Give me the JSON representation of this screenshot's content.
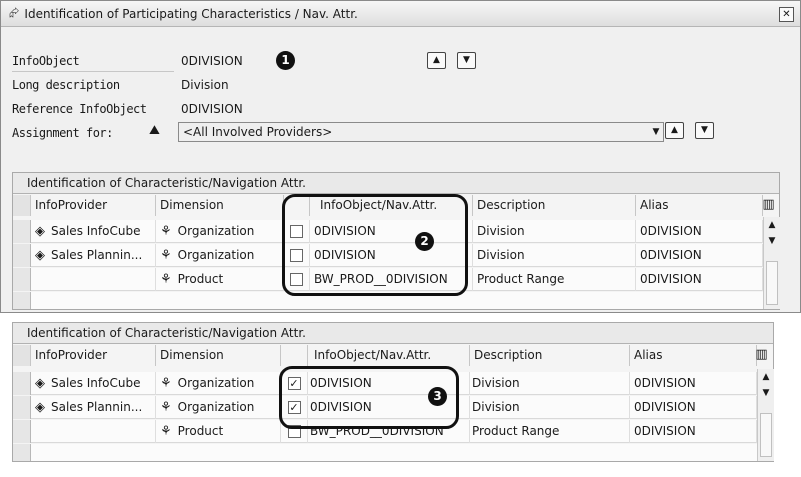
{
  "dialog": {
    "title": "Identification of Participating Characteristics / Nav. Attr.",
    "fields": {
      "infoobject_label": "InfoObject",
      "infoobject_value": "0DIVISION",
      "long_desc_label": "Long description",
      "long_desc_value": "Division",
      "reference_label": "Reference InfoObject",
      "reference_value": "0DIVISION",
      "assignment_label": "Assignment for:",
      "assignment_value": "<All Involved Providers>"
    },
    "badges": [
      "1",
      "2",
      "3"
    ]
  },
  "table_caption": "Identification of Characteristic/Navigation Attr.",
  "columns": [
    "InfoProvider",
    "Dimension",
    "InfoObject/Nav.Attr.",
    "Description",
    "Alias"
  ],
  "table1_rows": [
    {
      "provider": "Sales InfoCube",
      "dimension": "Organization",
      "infoobject": "0DIVISION",
      "description": "Division",
      "alias": "0DIVISION",
      "checked": false
    },
    {
      "provider": "Sales Plannin...",
      "dimension": "Organization",
      "infoobject": "0DIVISION",
      "description": "Division",
      "alias": "0DIVISION",
      "checked": false
    },
    {
      "provider": "",
      "dimension": "Product",
      "infoobject": "BW_PROD__0DIVISION",
      "description": "Product Range",
      "alias": "0DIVISION",
      "checked": false
    }
  ],
  "table2_rows": [
    {
      "provider": "Sales InfoCube",
      "dimension": "Organization",
      "infoobject": "0DIVISION",
      "description": "Division",
      "alias": "0DIVISION",
      "checked": true
    },
    {
      "provider": "Sales Plannin...",
      "dimension": "Organization",
      "infoobject": "0DIVISION",
      "description": "Division",
      "alias": "0DIVISION",
      "checked": true
    },
    {
      "provider": "",
      "dimension": "Product",
      "infoobject": "BW_PROD__0DIVISION",
      "description": "Product Range",
      "alias": "0DIVISION",
      "checked": false
    }
  ]
}
